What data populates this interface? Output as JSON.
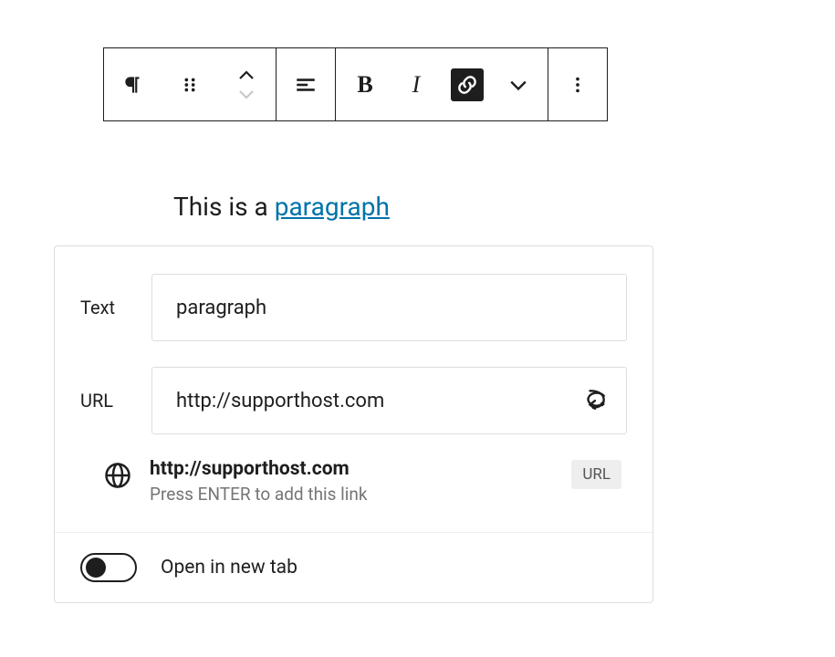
{
  "toolbar": {
    "block_icon": "paragraph",
    "drag_icon": "drag-handle",
    "move_up": "move-up",
    "move_down": "move-down",
    "align": "align-left",
    "bold": "B",
    "italic": "I",
    "link_icon": "link",
    "more_rich": "chevron-down",
    "options": "more-vertical"
  },
  "content": {
    "prefix": "This is a ",
    "link_text": "paragraph"
  },
  "link_popover": {
    "text_label": "Text",
    "text_value": "paragraph",
    "url_label": "URL",
    "url_value": "http://supporthost.com",
    "suggestion_title": "http://supporthost.com",
    "suggestion_hint": "Press ENTER to add this link",
    "badge": "URL",
    "new_tab_label": "Open in new tab",
    "new_tab_value": false
  }
}
